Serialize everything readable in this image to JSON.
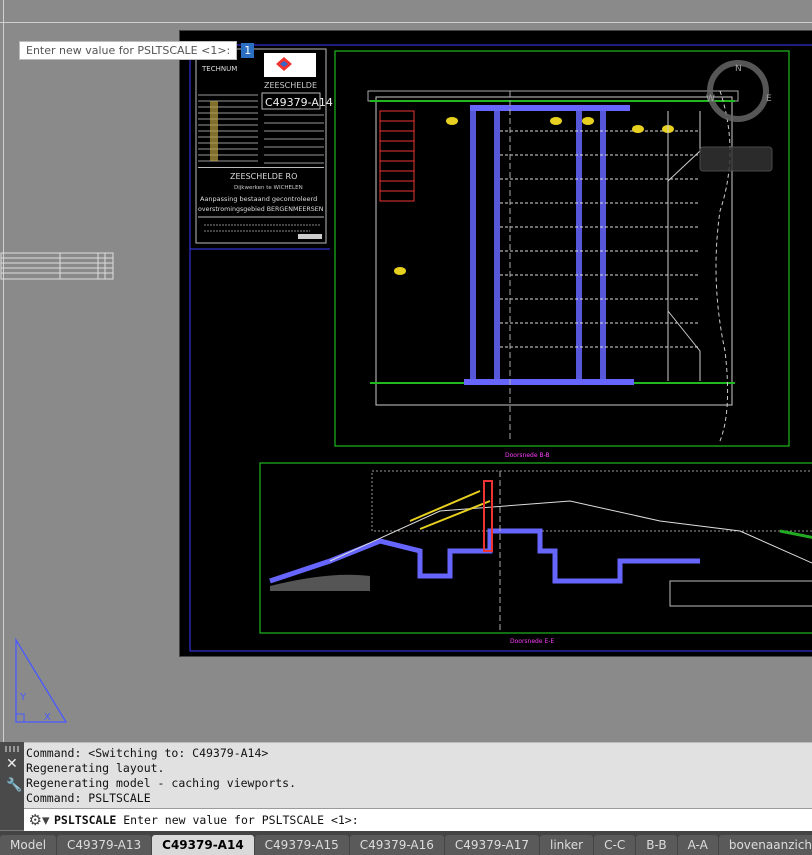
{
  "dynamic_input": {
    "prompt": "Enter new value for PSLTSCALE <1>:",
    "value": "1"
  },
  "title_block": {
    "company": "TECHNUM",
    "code_top": "ZEESCHELDE",
    "drawing_no": "C49379-A14",
    "project": "ZEESCHELDE RO",
    "line1": "Dijkwerken te WICHELEN",
    "line2": "Aanpassing bestaand gecontroleerd",
    "line3": "overstromingsgebied BERGENMEERSEN"
  },
  "section_labels": [
    "Doorsnede B-B",
    "Doorsnede E-E"
  ],
  "command_history": [
    "Command:   <Switching to: C49379-A14>",
    "Regenerating layout.",
    "Regenerating model - caching viewports.",
    "Command: PSLTSCALE"
  ],
  "command_line": {
    "command": "PSLTSCALE",
    "prompt": "Enter new value for PSLTSCALE <1>:"
  },
  "tabs": [
    {
      "label": "Model",
      "active": false
    },
    {
      "label": "C49379-A13",
      "active": false
    },
    {
      "label": "C49379-A14",
      "active": true
    },
    {
      "label": "C49379-A15",
      "active": false
    },
    {
      "label": "C49379-A16",
      "active": false
    },
    {
      "label": "C49379-A17",
      "active": false
    },
    {
      "label": "linker",
      "active": false
    },
    {
      "label": "C-C",
      "active": false
    },
    {
      "label": "B-B",
      "active": false
    },
    {
      "label": "A-A",
      "active": false
    },
    {
      "label": "bovenaanzicht",
      "active": false
    }
  ],
  "add_tab": "+",
  "viewcube": {
    "north": "N",
    "east": "E",
    "west": "W"
  },
  "icons": {
    "close": "close-icon",
    "customize": "wrench-icon",
    "options": "gear-icon"
  },
  "colors": {
    "canvas": "#8a8a8a",
    "paper": "#000000",
    "viewport_border": "#1fb81f",
    "accent_blue": "#5a5aff"
  }
}
